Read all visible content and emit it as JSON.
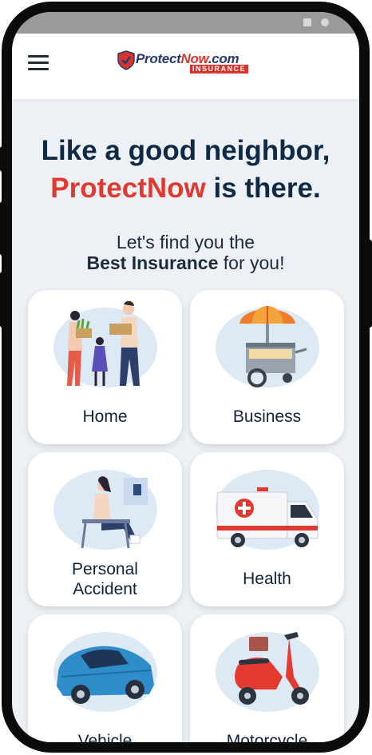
{
  "header": {
    "logo_protect": "Protect",
    "logo_now": "Now",
    "logo_domain": ".com",
    "logo_sub": "INSURANCE"
  },
  "hero": {
    "line1": "Like a good neighbor,",
    "brand": "ProtectNow",
    "line2_rest": " is there."
  },
  "subtitle": {
    "line1": "Let's find you the",
    "bold": "Best Insurance",
    "rest": " for you!"
  },
  "categories": [
    {
      "label": "Home",
      "icon": "family-home-icon"
    },
    {
      "label": "Business",
      "icon": "food-cart-icon"
    },
    {
      "label": "Personal",
      "label2": "Accident",
      "icon": "injured-person-icon"
    },
    {
      "label": "Health",
      "icon": "ambulance-icon"
    },
    {
      "label": "Vehicle",
      "icon": "car-icon"
    },
    {
      "label": "Motorcycle",
      "icon": "scooter-icon"
    }
  ],
  "colors": {
    "brand_red": "#e03a30",
    "navy": "#0f2a45",
    "background": "#edf1f5",
    "card": "#ffffff"
  }
}
